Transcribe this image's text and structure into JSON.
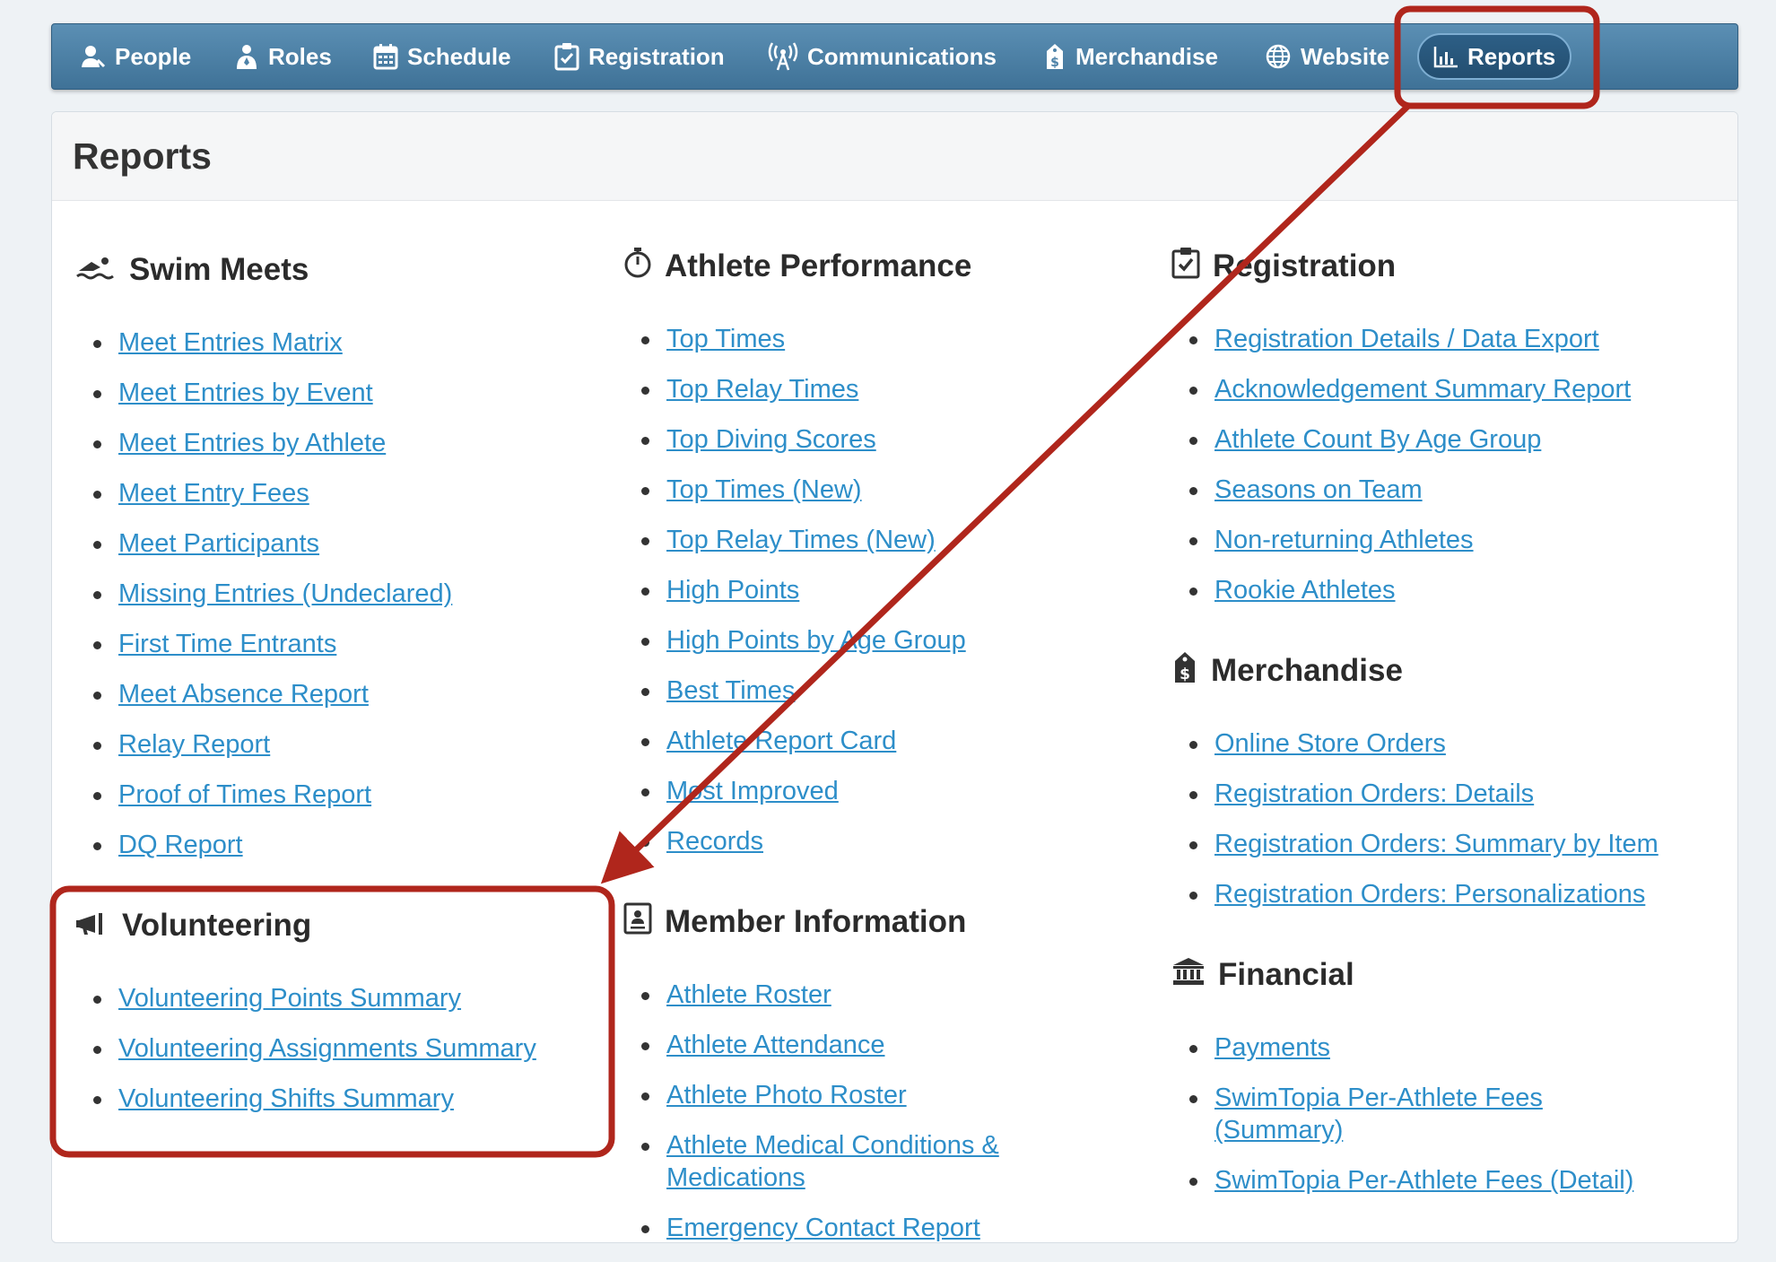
{
  "nav": {
    "items": [
      {
        "label": "People",
        "icon": "person-icon"
      },
      {
        "label": "Roles",
        "icon": "role-icon"
      },
      {
        "label": "Schedule",
        "icon": "calendar-icon"
      },
      {
        "label": "Registration",
        "icon": "clipboard-check-icon"
      },
      {
        "label": "Communications",
        "icon": "broadcast-icon"
      },
      {
        "label": "Merchandise",
        "icon": "price-tag-icon"
      },
      {
        "label": "Website",
        "icon": "globe-icon"
      },
      {
        "label": "Reports",
        "icon": "bar-chart-icon",
        "active": true
      }
    ]
  },
  "page": {
    "title": "Reports"
  },
  "sections": {
    "swim_meets": {
      "title": "Swim Meets",
      "icon": "swimmer-icon",
      "links": [
        "Meet Entries Matrix",
        "Meet Entries by Event",
        "Meet Entries by Athlete",
        "Meet Entry Fees",
        "Meet Participants",
        "Missing Entries (Undeclared)",
        "First Time Entrants",
        "Meet Absence Report",
        "Relay Report",
        "Proof of Times Report",
        "DQ Report"
      ]
    },
    "volunteering": {
      "title": "Volunteering",
      "icon": "megaphone-icon",
      "links": [
        "Volunteering Points Summary",
        "Volunteering Assignments Summary",
        "Volunteering Shifts Summary"
      ]
    },
    "athlete_performance": {
      "title": "Athlete Performance",
      "icon": "stopwatch-icon",
      "links": [
        "Top Times",
        "Top Relay Times",
        "Top Diving Scores",
        "Top Times (New)",
        "Top Relay Times (New)",
        "High Points",
        "High Points by Age Group",
        "Best Times",
        "Athlete Report Card",
        "Most Improved",
        "Records"
      ]
    },
    "member_information": {
      "title": "Member Information",
      "icon": "id-card-icon",
      "links": [
        "Athlete Roster",
        "Athlete Attendance",
        "Athlete Photo Roster",
        "Athlete Medical Conditions & Medications",
        "Emergency Contact Report"
      ]
    },
    "registration": {
      "title": "Registration",
      "icon": "clipboard-check-icon",
      "links": [
        "Registration Details / Data Export",
        "Acknowledgement Summary Report",
        "Athlete Count By Age Group",
        "Seasons on Team",
        "Non-returning Athletes",
        "Rookie Athletes"
      ]
    },
    "merchandise": {
      "title": "Merchandise",
      "icon": "price-tag-icon",
      "links": [
        "Online Store Orders",
        "Registration Orders: Details",
        "Registration Orders: Summary by Item",
        "Registration Orders: Personalizations"
      ]
    },
    "financial": {
      "title": "Financial",
      "icon": "bank-icon",
      "links": [
        "Payments",
        "SwimTopia Per-Athlete Fees (Summary)",
        "SwimTopia Per-Athlete Fees (Detail)"
      ]
    }
  },
  "colors": {
    "link": "#2d8ec9",
    "nav": "#4d82a8",
    "annotation": "#b0261c"
  }
}
